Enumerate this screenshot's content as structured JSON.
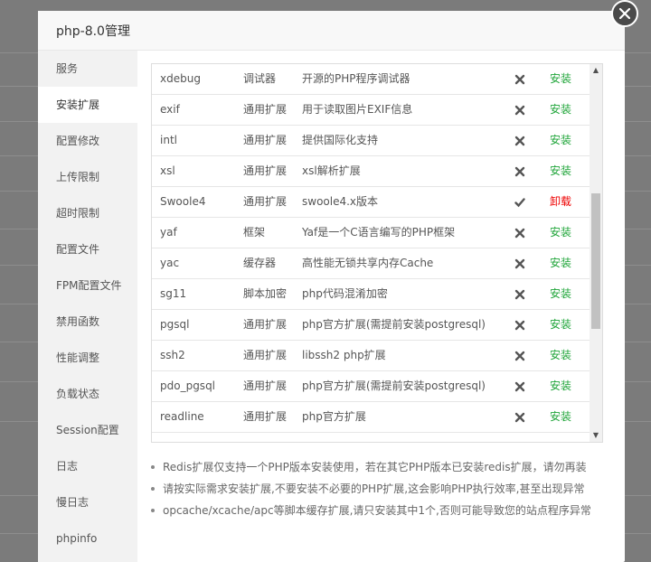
{
  "modal": {
    "title": "php-8.0管理"
  },
  "sidebar": {
    "items": [
      {
        "label": "服务"
      },
      {
        "label": "安装扩展"
      },
      {
        "label": "配置修改"
      },
      {
        "label": "上传限制"
      },
      {
        "label": "超时限制"
      },
      {
        "label": "配置文件"
      },
      {
        "label": "FPM配置文件"
      },
      {
        "label": "禁用函数"
      },
      {
        "label": "性能调整"
      },
      {
        "label": "负载状态"
      },
      {
        "label": "Session配置"
      },
      {
        "label": "日志"
      },
      {
        "label": "慢日志"
      },
      {
        "label": "phpinfo"
      }
    ],
    "active_index": 1
  },
  "extensions": [
    {
      "name": "xdebug",
      "type": "调试器",
      "desc": "开源的PHP程序调试器",
      "installed": false,
      "action": "安装"
    },
    {
      "name": "exif",
      "type": "通用扩展",
      "desc": "用于读取图片EXIF信息",
      "installed": false,
      "action": "安装"
    },
    {
      "name": "intl",
      "type": "通用扩展",
      "desc": "提供国际化支持",
      "installed": false,
      "action": "安装"
    },
    {
      "name": "xsl",
      "type": "通用扩展",
      "desc": "xsl解析扩展",
      "installed": false,
      "action": "安装"
    },
    {
      "name": "Swoole4",
      "type": "通用扩展",
      "desc": "swoole4.x版本",
      "installed": true,
      "action": "卸载"
    },
    {
      "name": "yaf",
      "type": "框架",
      "desc": "Yaf是一个C语言编写的PHP框架",
      "installed": false,
      "action": "安装"
    },
    {
      "name": "yac",
      "type": "缓存器",
      "desc": "高性能无锁共享内存Cache",
      "installed": false,
      "action": "安装"
    },
    {
      "name": "sg11",
      "type": "脚本加密",
      "desc": "php代码混淆加密",
      "installed": false,
      "action": "安装"
    },
    {
      "name": "pgsql",
      "type": "通用扩展",
      "desc": "php官方扩展(需提前安装postgresql)",
      "installed": false,
      "action": "安装"
    },
    {
      "name": "ssh2",
      "type": "通用扩展",
      "desc": "libssh2 php扩展",
      "installed": false,
      "action": "安装"
    },
    {
      "name": "pdo_pgsql",
      "type": "通用扩展",
      "desc": "php官方扩展(需提前安装postgresql)",
      "installed": false,
      "action": "安装"
    },
    {
      "name": "readline",
      "type": "通用扩展",
      "desc": "php官方扩展",
      "installed": false,
      "action": "安装"
    }
  ],
  "notes": [
    "Redis扩展仅支持一个PHP版本安装使用，若在其它PHP版本已安装redis扩展，请勿再装",
    "请按实际需求安装扩展,不要安装不必要的PHP扩展,这会影响PHP执行效率,甚至出现异常",
    "opcache/xcache/apc等脚本缓存扩展,请只安装其中1个,否则可能导致您的站点程序异常"
  ],
  "colors": {
    "install": "#20a53a",
    "uninstall": "#e00000",
    "close_bg": "#4a4a4a"
  },
  "icons": {
    "not_installed": "cross-icon",
    "installed": "check-icon"
  }
}
